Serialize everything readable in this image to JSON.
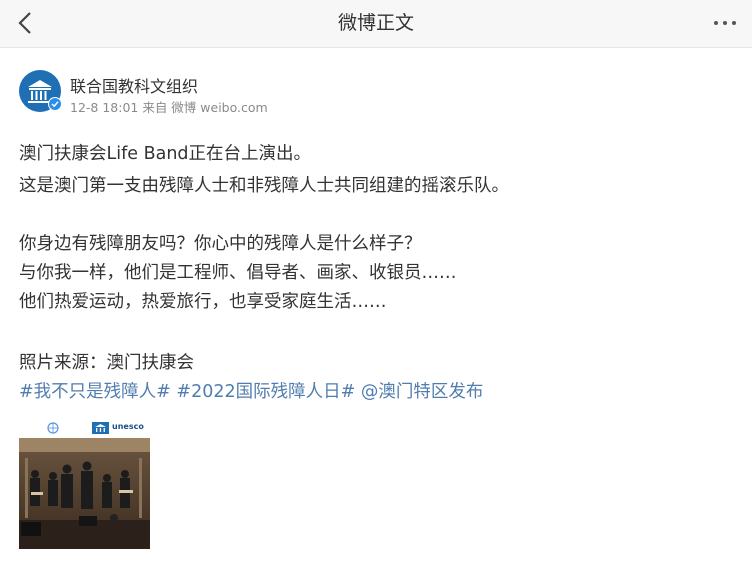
{
  "header": {
    "title": "微博正文",
    "back_icon": "chevron-left-icon",
    "more_icon": "more-dots-icon"
  },
  "post": {
    "author": "联合国教科文组织",
    "meta": "12-8 18:01 来自 微博 weibo.com",
    "lines": [
      "澳门扶康会Life Band正在台上演出。",
      "这是澳门第一支由残障人士和非残障人士共同组建的摇滚乐队。",
      "你身边有残障朋友吗？你心中的残障人是什么样子？",
      "与你我一样，他们是工程师、倡导者、画家、收银员……",
      "他们热爱运动，热爱旅行，也享受家庭生活……",
      "照片来源：澳门扶康会"
    ],
    "tags": [
      "#我不只是残障人#",
      "#2022国际残障人日#",
      "@澳门特区发布"
    ],
    "photo": {
      "banner_text": "unesco"
    }
  },
  "colors": {
    "link": "#507daf",
    "verified": "#2a8de9",
    "avatar_bg": "#1f6fb4"
  }
}
